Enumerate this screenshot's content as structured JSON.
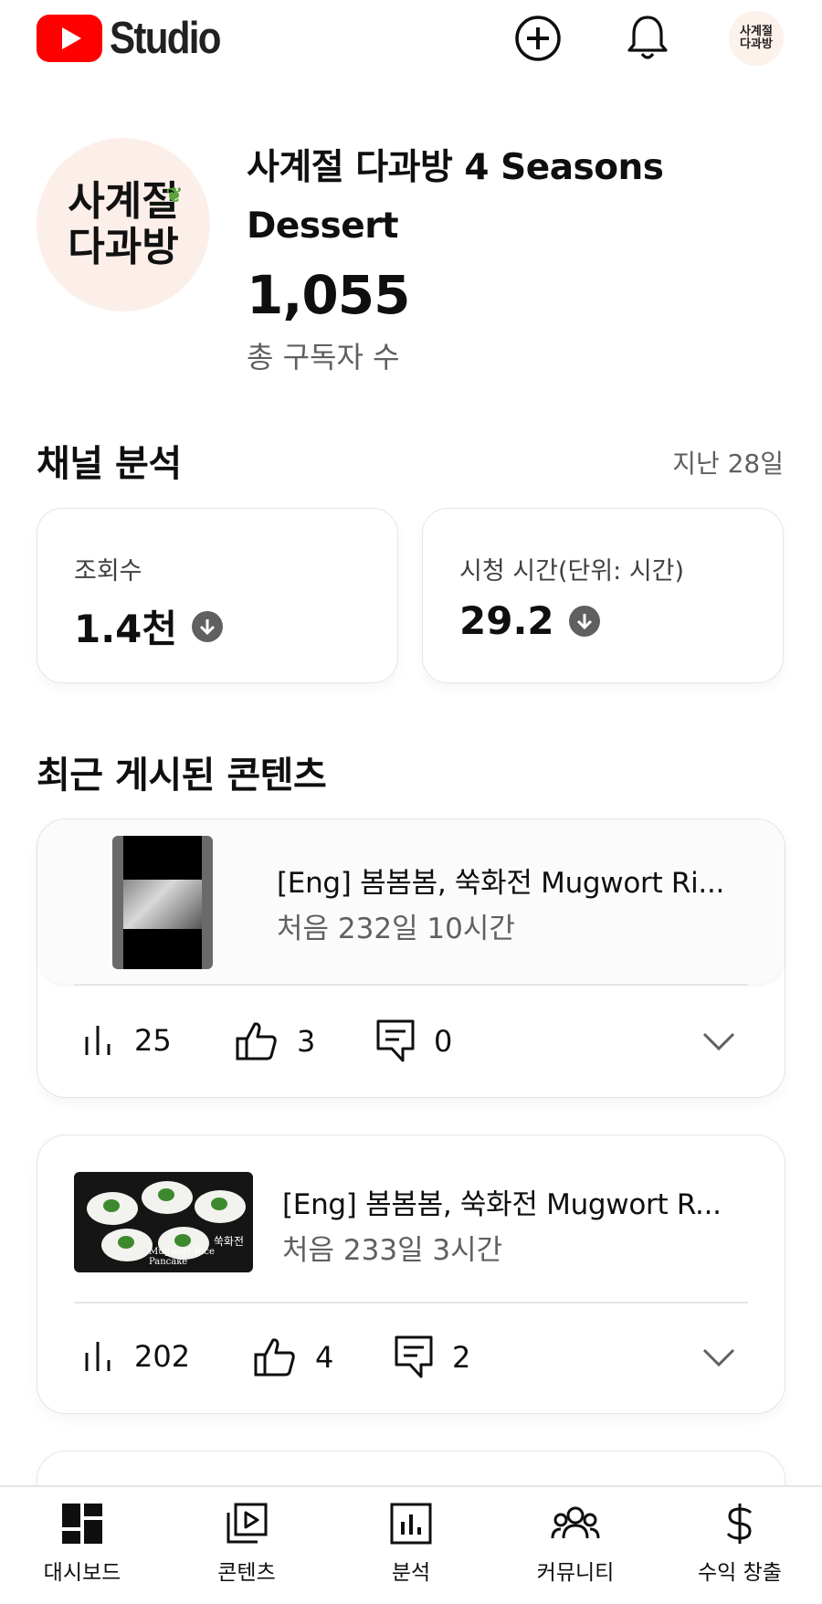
{
  "header": {
    "logo_text": "Studio",
    "create_icon": "plus-circle-icon",
    "notifications_icon": "bell-icon",
    "account_avatar_text": [
      "사계절",
      "다과방"
    ]
  },
  "channel": {
    "avatar_text": [
      "사계절",
      "다과방"
    ],
    "name": "사계절 다과방 4 Seasons Dessert",
    "subscriber_count": "1,055",
    "subscriber_label": "총 구독자 수"
  },
  "analytics": {
    "title": "채널 분석",
    "period": "지난 28일",
    "metrics": [
      {
        "label": "조회수",
        "value": "1.4천",
        "trend_icon": "arrow-down-circle-icon"
      },
      {
        "label": "시청 시간(단위: 시간)",
        "value": "29.2",
        "trend_icon": "arrow-down-circle-icon"
      }
    ]
  },
  "recent": {
    "title": "최근 게시된 콘텐츠",
    "items": [
      {
        "title": "[Eng] 봄봄봄, 쑥화전   Mugwort Ri...",
        "published": "처음 232일 10시간",
        "views": "25",
        "likes": "3",
        "comments": "0"
      },
      {
        "title": "[Eng] 봄봄봄, 쑥화전   Mugwort R...",
        "published": "처음 233일 3시간",
        "views": "202",
        "likes": "4",
        "comments": "2",
        "thumb_caption": "Mugwort Rice Pancake",
        "thumb_caption_ko": "쑥화전"
      }
    ]
  },
  "nav": [
    {
      "label": "대시보드",
      "icon": "dashboard-icon"
    },
    {
      "label": "콘텐츠",
      "icon": "content-icon"
    },
    {
      "label": "분석",
      "icon": "analytics-icon"
    },
    {
      "label": "커뮤니티",
      "icon": "community-icon"
    },
    {
      "label": "수익 창출",
      "icon": "dollar-icon"
    }
  ]
}
